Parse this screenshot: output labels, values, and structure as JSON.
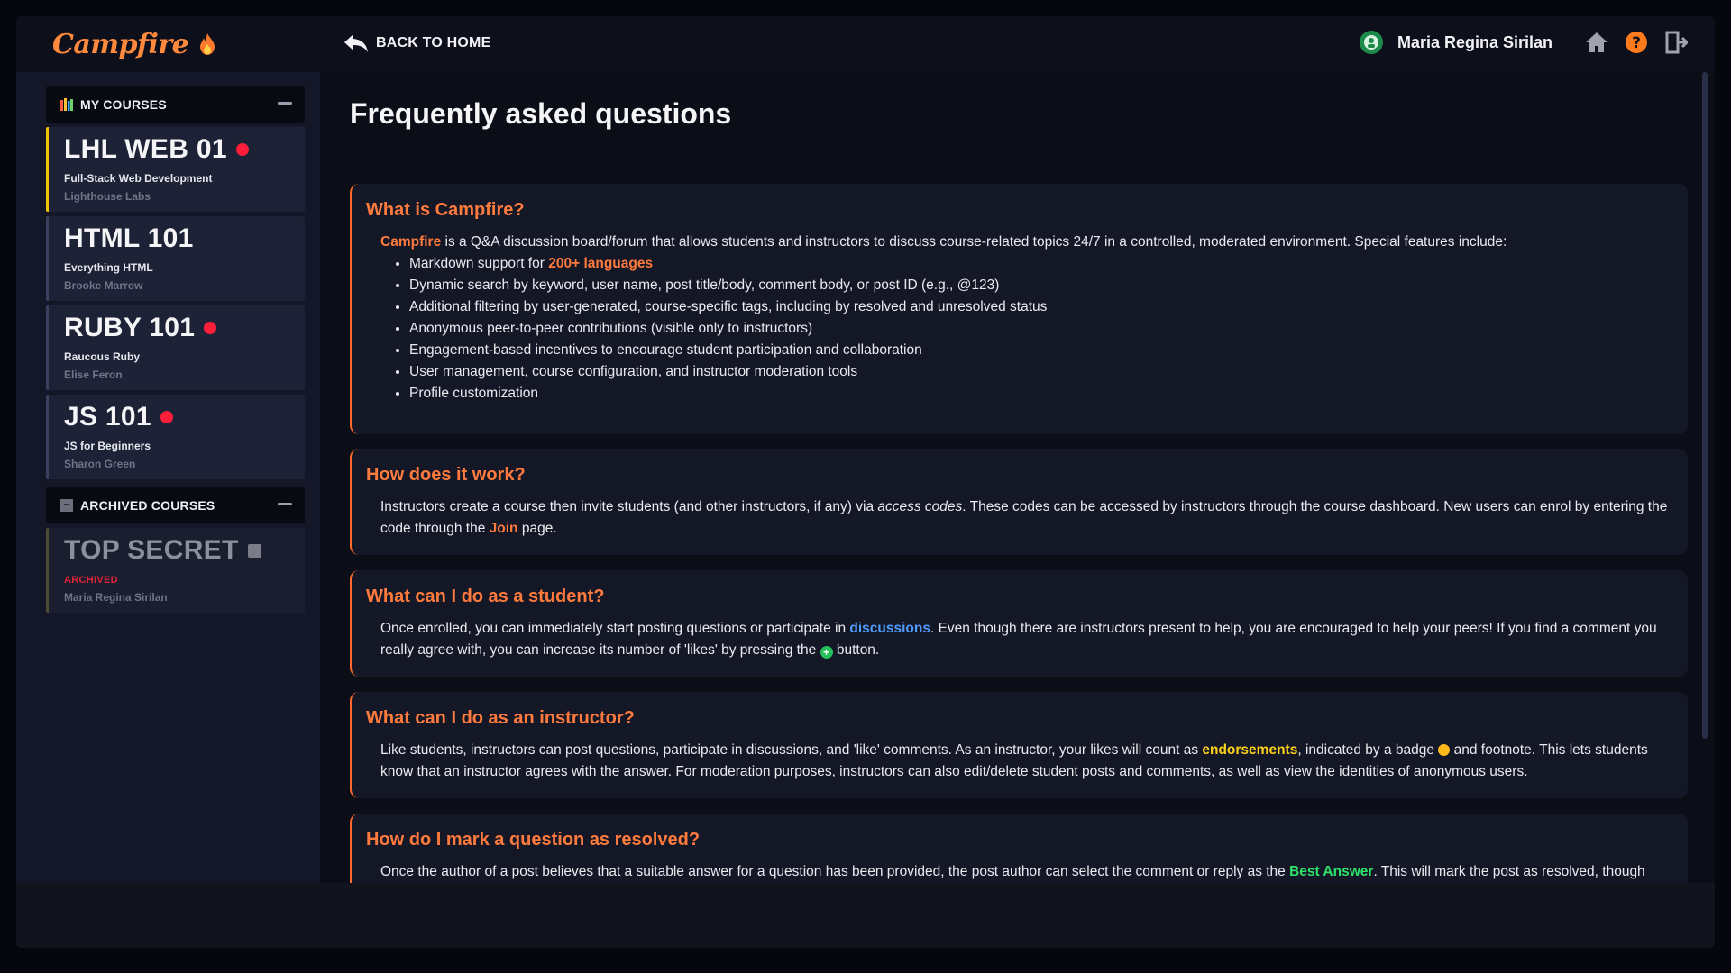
{
  "app": {
    "logo": "Campfire"
  },
  "topbar": {
    "back_label": "BACK TO HOME",
    "user_name": "Maria Regina Sirilan"
  },
  "sidebar": {
    "my_courses_title": "MY COURSES",
    "archived_title": "ARCHIVED COURSES",
    "courses": [
      {
        "code": "LHL WEB 01",
        "name": "Full-Stack Web Development",
        "instructor": "Lighthouse Labs",
        "unread": true
      },
      {
        "code": "HTML 101",
        "name": "Everything HTML",
        "instructor": "Brooke Marrow",
        "unread": false
      },
      {
        "code": "RUBY 101",
        "name": "Raucous Ruby",
        "instructor": "Elise Feron",
        "unread": true
      },
      {
        "code": "JS 101",
        "name": "JS for Beginners",
        "instructor": "Sharon Green",
        "unread": true
      }
    ],
    "archived": [
      {
        "code": "TOP SECRET",
        "tag": "ARCHIVED",
        "instructor": "Maria Regina Sirilan"
      }
    ]
  },
  "main": {
    "title": "Frequently asked questions",
    "faqs": {
      "q1": {
        "question": "What is Campfire?",
        "lead_brand": "Campfire",
        "lead_text": " is a Q&A discussion board/forum that allows students and instructors to discuss course-related topics 24/7 in a controlled, moderated environment. Special features include:",
        "bullet_1_pre": "Markdown support for ",
        "bullet_1_link": "200+ languages",
        "bullet_2": "Dynamic search by keyword, user name, post title/body, comment body, or post ID (e.g., @123)",
        "bullet_3": "Additional filtering by user-generated, course-specific tags, including by resolved and unresolved status",
        "bullet_4": "Anonymous peer-to-peer contributions (visible only to instructors)",
        "bullet_5": "Engagement-based incentives to encourage student participation and collaboration",
        "bullet_6": "User management, course configuration, and instructor moderation tools",
        "bullet_7": "Profile customization"
      },
      "q2": {
        "question": "How does it work?",
        "t1": "Instructors create a course then invite students (and other instructors, if any) via ",
        "em": "access codes",
        "t2": ". These codes can be accessed by instructors through the course dashboard. New users can enrol by entering the code through the ",
        "link": "Join",
        "t3": " page."
      },
      "q3": {
        "question": "What can I do as a student?",
        "t1": "Once enrolled, you can immediately start posting questions or participate in ",
        "link": "discussions",
        "t2": ". Even though there are instructors present to help, you are encouraged to help your peers! If you find a comment you really agree with, you can increase its number of 'likes' by pressing the ",
        "t3": " button."
      },
      "q4": {
        "question": "What can I do as an instructor?",
        "t1": "Like students, instructors can post questions, participate in discussions, and 'like' comments. As an instructor, your likes will count as ",
        "link": "endorsements",
        "t2": ", indicated by a badge ",
        "t3": " and footnote. This lets students know that an instructor agrees with the answer. For moderation purposes, instructors can also edit/delete student posts and comments, as well as view the identities of anonymous users."
      },
      "q5": {
        "question": "How do I mark a question as resolved?",
        "t1": "Once the author of a post believes that a suitable answer for a question has been provided, the post author can select the comment or reply as the ",
        "link": "Best Answer",
        "t2": ". This will mark the post as resolved, though discussions may continue."
      }
    }
  }
}
